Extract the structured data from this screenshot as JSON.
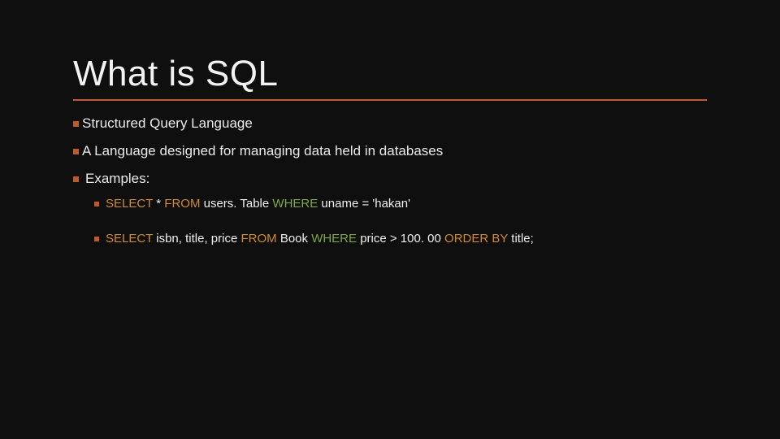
{
  "title": "What is SQL",
  "bullets": {
    "b1": "Structured Query Language",
    "b2": "A Language designed for managing data held in databases",
    "b3": "Examples:"
  },
  "examples": {
    "e1": {
      "select": "SELECT",
      "star": " * ",
      "from": "FROM",
      "t1": " users. Table ",
      "where": "WHERE",
      "cond": " uname = 'hakan'"
    },
    "e2": {
      "select": "SELECT",
      "cols": " isbn, title, price ",
      "from": "FROM",
      "t1": "  Book ",
      "where": "WHERE",
      "cond": " price > 100. 00 ",
      "orderby": "ORDER BY",
      "ordcol": " title;"
    }
  }
}
